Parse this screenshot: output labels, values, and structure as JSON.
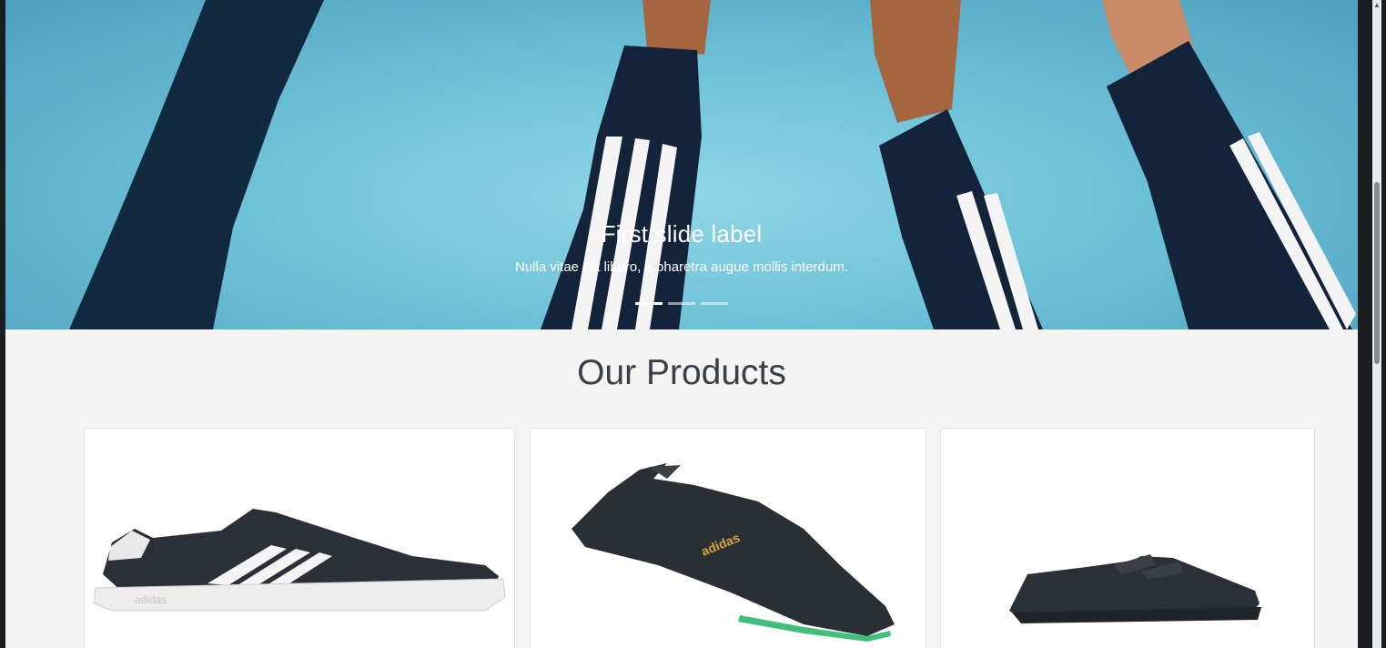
{
  "carousel": {
    "active_slide": 1,
    "slides": [
      {
        "label": "First slide label",
        "text": "Nulla vitae elit libero, a pharetra augue mollis interdum."
      }
    ],
    "indicator_count": 3
  },
  "products": {
    "title": "Our Products",
    "items": [
      {
        "image": "black-white-striped-sneaker",
        "logo_text": "adidas"
      },
      {
        "image": "black-green-sole-sneaker",
        "logo_text": "adidas"
      },
      {
        "image": "black-velcro-shoe"
      }
    ]
  },
  "colors": {
    "hero_sky": "#6ec2d8",
    "page_bg": "#f3f4f3",
    "title_text": "#3b4048",
    "shoe_black": "#2b3038",
    "green_sole": "#3fbf7a"
  }
}
